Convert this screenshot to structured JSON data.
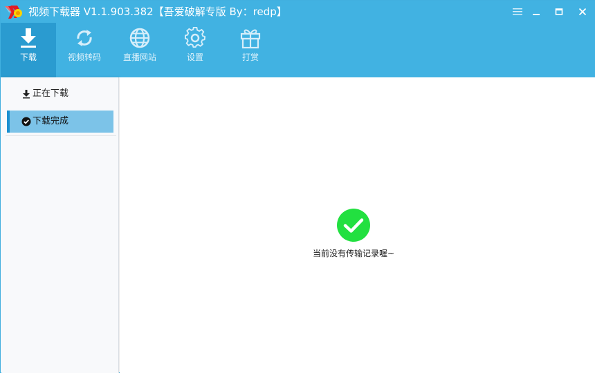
{
  "window": {
    "title": "视频下载器 V1.1.903.382【吾爱破解专版  By：redp】"
  },
  "controls": {
    "menu_icon": "hamburger-icon",
    "minimize_icon": "minimize-icon",
    "maximize_icon": "maximize-icon",
    "close_icon": "close-icon"
  },
  "toolbar": {
    "items": [
      {
        "label": "下载",
        "icon": "download-icon",
        "active": true
      },
      {
        "label": "视频转码",
        "icon": "refresh-arrows-icon",
        "active": false
      },
      {
        "label": "直播网站",
        "icon": "globe-icon",
        "active": false
      },
      {
        "label": "设置",
        "icon": "gear-icon",
        "active": false
      },
      {
        "label": "打赏",
        "icon": "gift-icon",
        "active": false
      }
    ]
  },
  "sidebar": {
    "items": [
      {
        "label": "正在下载",
        "icon": "download-small-icon",
        "selected": false
      },
      {
        "label": "下载完成",
        "icon": "check-circle-icon",
        "selected": true
      }
    ]
  },
  "main": {
    "empty_icon": "check-circle-icon",
    "empty_message": "当前没有传输记录喔~"
  },
  "colors": {
    "header": "#41b2e2",
    "active_tab": "#2a9bd0",
    "selected_item": "#7cc3e8",
    "selected_bar": "#1a8fd0",
    "success": "#22e040"
  }
}
